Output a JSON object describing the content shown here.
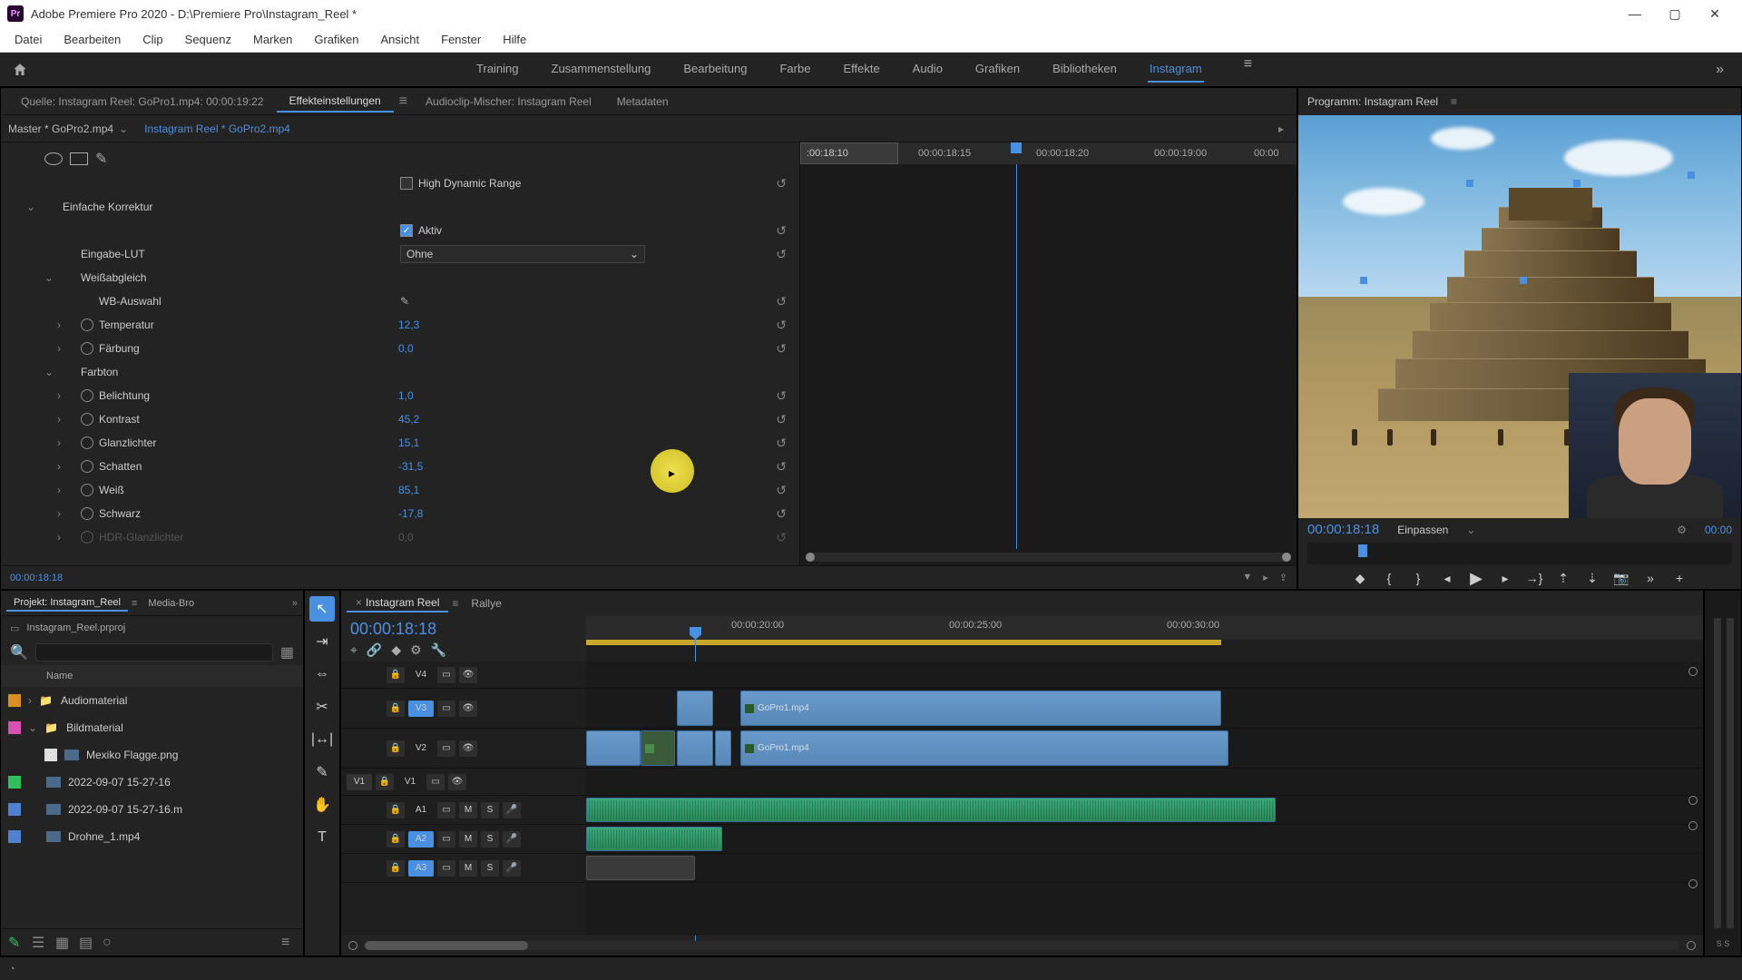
{
  "titlebar": {
    "app": "Adobe Premiere Pro 2020",
    "project": "D:\\Premiere Pro\\Instagram_Reel *"
  },
  "menu": [
    "Datei",
    "Bearbeiten",
    "Clip",
    "Sequenz",
    "Marken",
    "Grafiken",
    "Ansicht",
    "Fenster",
    "Hilfe"
  ],
  "workspaces": {
    "items": [
      "Training",
      "Zusammenstellung",
      "Bearbeitung",
      "Farbe",
      "Effekte",
      "Audio",
      "Grafiken",
      "Bibliotheken",
      "Instagram"
    ],
    "active": "Instagram"
  },
  "source_tabs": {
    "items": [
      "Quelle: Instagram Reel: GoPro1.mp4: 00:00:19:22",
      "Effekteinstellungen",
      "Audioclip-Mischer: Instagram Reel",
      "Metadaten"
    ],
    "active_index": 1
  },
  "effects": {
    "master": "Master * GoPro2.mp4",
    "clip": "Instagram Reel * GoPro2.mp4",
    "hdr_label": "High Dynamic Range",
    "groups": {
      "simple_correction": "Einfache Korrektur",
      "aktiv": "Aktiv",
      "input_lut": "Eingabe-LUT",
      "input_lut_value": "Ohne",
      "white_balance": "Weißabgleich",
      "wb_select": "WB-Auswahl",
      "temperature": "Temperatur",
      "temperature_val": "12,3",
      "tint": "Färbung",
      "tint_val": "0,0",
      "tone": "Farbton",
      "exposure": "Belichtung",
      "exposure_val": "1,0",
      "contrast": "Kontrast",
      "contrast_val": "45,2",
      "highlights": "Glanzlichter",
      "highlights_val": "15,1",
      "shadows": "Schatten",
      "shadows_val": "-31,5",
      "whites": "Weiß",
      "whites_val": "85,1",
      "blacks": "Schwarz",
      "blacks_val": "-17,8",
      "hdr_highlights": "HDR-Glanzlichter",
      "hdr_highlights_val": "0,0"
    },
    "mini_timeline": {
      "playhead_box": ":00:18:10",
      "ticks": [
        "00:00:18:15",
        "00:00:18:20",
        "00:00:19:00",
        "00:00"
      ]
    },
    "footer_tc": "00:00:18:18"
  },
  "program": {
    "title": "Programm: Instagram Reel",
    "tc": "00:00:18:18",
    "fit": "Einpassen",
    "tc_right": "00:00"
  },
  "project": {
    "tab": "Projekt: Instagram_Reel",
    "tab2": "Media-Bro",
    "file": "Instagram_Reel.prproj",
    "name_header": "Name",
    "items": [
      {
        "color": "#d89020",
        "type": "folder",
        "name": "Audiomaterial",
        "expand": true
      },
      {
        "color": "#d850b0",
        "type": "folder",
        "name": "Bildmaterial",
        "expand": true,
        "open": true
      },
      {
        "color": "#e0e0e0",
        "type": "file",
        "name": "Mexiko Flagge.png",
        "indent": 1
      },
      {
        "color": "#30c060",
        "type": "file",
        "name": "2022-09-07 15-27-16",
        "indent": 0
      },
      {
        "color": "#5080d0",
        "type": "file",
        "name": "2022-09-07 15-27-16.m",
        "indent": 0
      },
      {
        "color": "#5080d0",
        "type": "file",
        "name": "Drohne_1.mp4",
        "indent": 0
      }
    ]
  },
  "timeline": {
    "tab1": "Instagram Reel",
    "tab2": "Rallye",
    "tc": "00:00:18:18",
    "ruler_ticks": [
      "00:00:20:00",
      "00:00:25:00",
      "00:00:30:00"
    ],
    "tracks": {
      "v4": "V4",
      "v3": "V3",
      "v2": "V2",
      "v1": "V1",
      "a1": "A1",
      "a2": "A2",
      "a3": "A3",
      "v1_patch": "V1"
    },
    "clips": {
      "gopro1_v3": "GoPro1.mp4",
      "gopro1_v2": "GoPro1.mp4"
    },
    "meter_label": "S S"
  }
}
